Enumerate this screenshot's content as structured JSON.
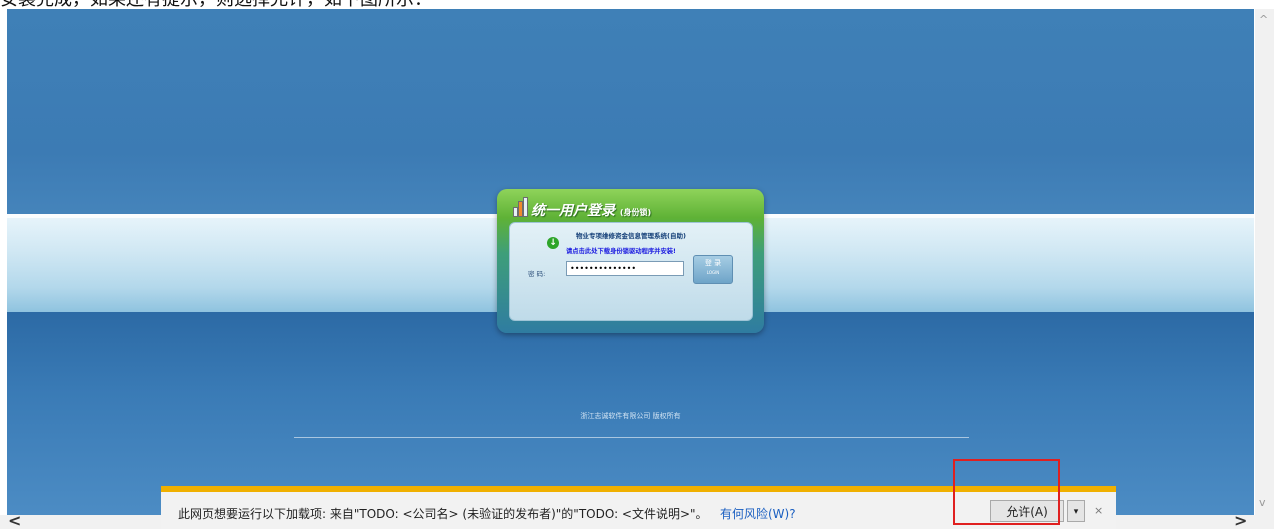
{
  "top_text": "安装完成，如果还有提示，则选择允许，如下图所示：",
  "login": {
    "title": "统一用户登录",
    "title_suffix": "(身份锁)",
    "system_name": "物业专项维修资金信息管理系统(自助)",
    "download_link": "请点击此处下载身份锁驱动程序并安装!",
    "password_label": "密 码:",
    "password_value": "••••••••••••••",
    "login_button": "登 录",
    "login_button_sub": "LOGIN"
  },
  "copyright": "浙江志诚软件有限公司 版权所有",
  "notification": {
    "message": "此网页想要运行以下加载项: 来自\"TODO: <公司名> (未验证的发布者)\"的\"TODO: <文件说明>\"。",
    "risk_link": "有何风险(W)?",
    "allow_button": "允许(A)",
    "dropdown_icon": "▾",
    "close_icon": "×"
  },
  "scroll": {
    "up": "^",
    "down": "v",
    "left": "<",
    "right": ">"
  },
  "colors": {
    "accent": "#f0b000",
    "highlight": "#e02020",
    "background": "#3d7fb8"
  }
}
